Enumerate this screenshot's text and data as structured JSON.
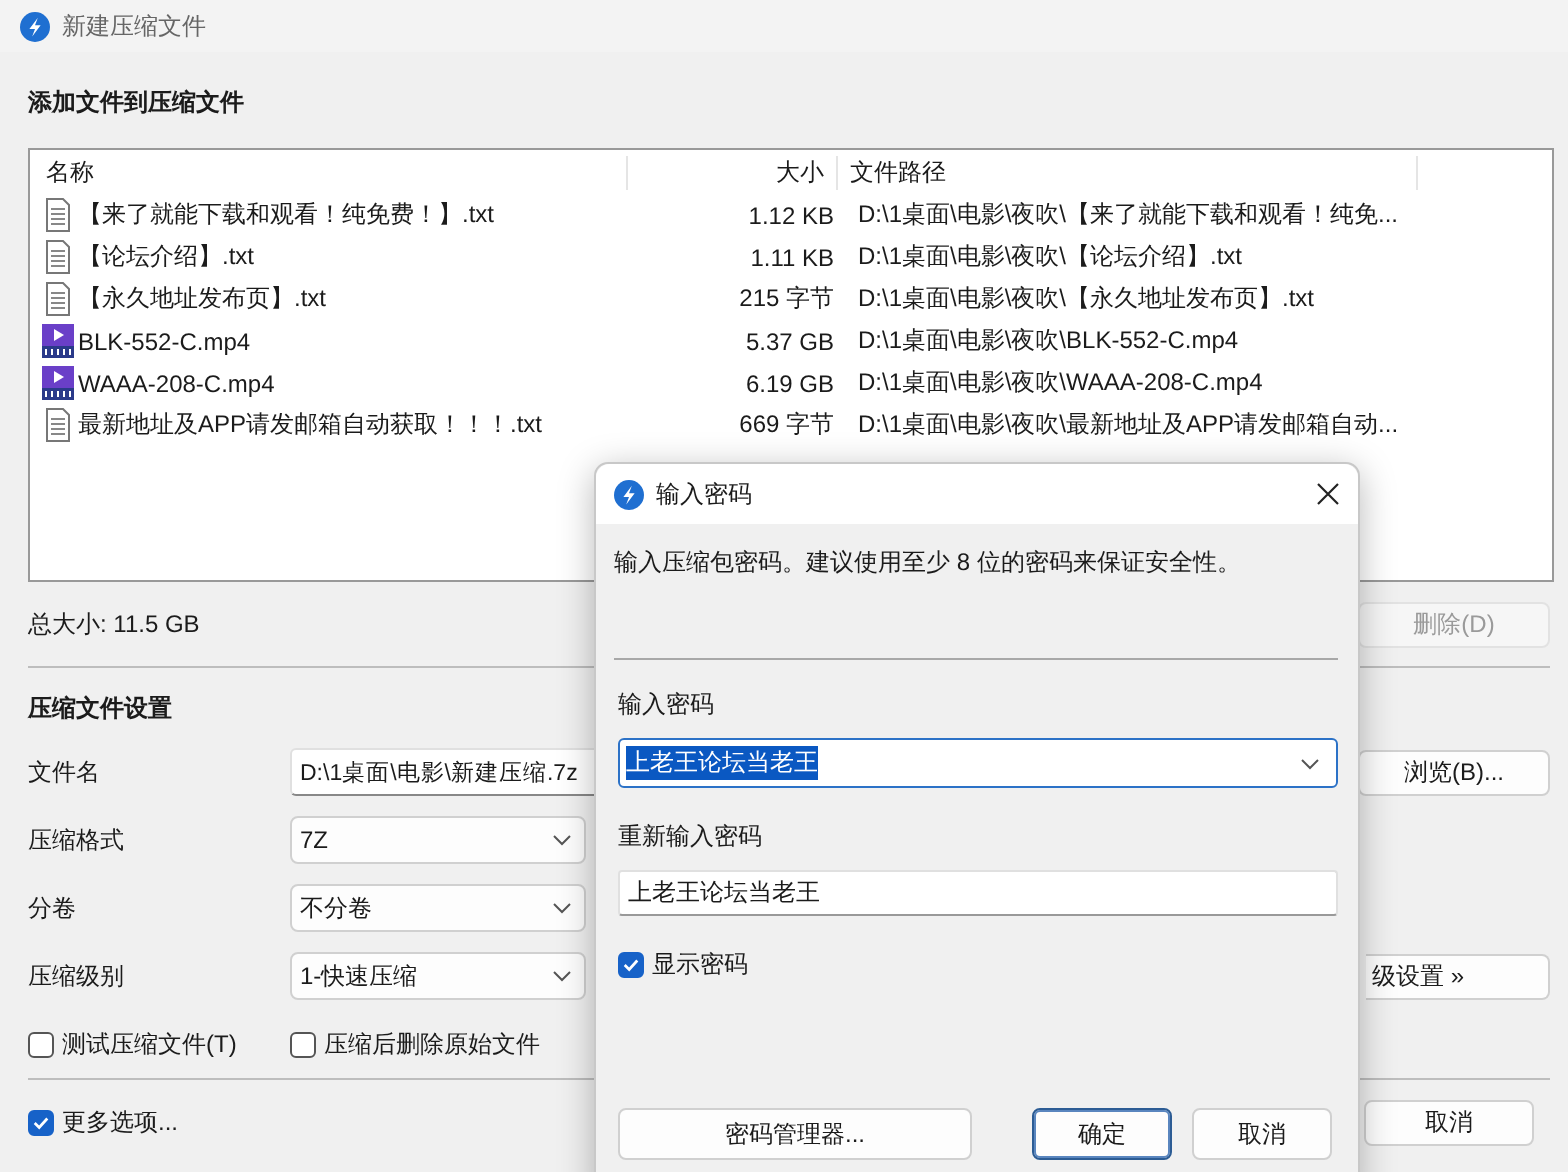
{
  "window": {
    "title": "新建压缩文件"
  },
  "files_section": {
    "heading": "添加文件到压缩文件",
    "columns": [
      "名称",
      "大小",
      "文件路径"
    ],
    "rows": [
      {
        "kind": "text",
        "name": "【来了就能下载和观看！纯免费！】.txt",
        "size": "1.12 KB",
        "path": "D:\\1桌面\\电影\\夜吹\\【来了就能下载和观看！纯免..."
      },
      {
        "kind": "text",
        "name": "【论坛介绍】.txt",
        "size": "1.11 KB",
        "path": "D:\\1桌面\\电影\\夜吹\\【论坛介绍】.txt"
      },
      {
        "kind": "text",
        "name": "【永久地址发布页】.txt",
        "size": "215 字节",
        "path": "D:\\1桌面\\电影\\夜吹\\【永久地址发布页】.txt"
      },
      {
        "kind": "video",
        "name": "BLK-552-C.mp4",
        "size": "5.37 GB",
        "path": "D:\\1桌面\\电影\\夜吹\\BLK-552-C.mp4"
      },
      {
        "kind": "video",
        "name": "WAAA-208-C.mp4",
        "size": "6.19 GB",
        "path": "D:\\1桌面\\电影\\夜吹\\WAAA-208-C.mp4"
      },
      {
        "kind": "text",
        "name": "最新地址及APP请发邮箱自动获取！！！.txt",
        "size": "669 字节",
        "path": "D:\\1桌面\\电影\\夜吹\\最新地址及APP请发邮箱自动..."
      }
    ],
    "total": "总大小: 11.5 GB",
    "delete_button": {
      "label": "删除(D)",
      "disabled": true
    }
  },
  "settings": {
    "heading": "压缩文件设置",
    "file_name": {
      "label": "文件名",
      "value": "D:\\1桌面\\电影\\新建压缩.7z"
    },
    "browse_button": "浏览(B)...",
    "selects": [
      {
        "label": "压缩格式",
        "value": "7Z"
      },
      {
        "label": "分卷",
        "value": "不分卷"
      },
      {
        "label": "压缩级别",
        "value": "1-快速压缩"
      }
    ],
    "advanced_button": "级设置 »",
    "options": [
      {
        "label": "测试压缩文件(T)",
        "checked": false
      },
      {
        "label": "压缩后删除原始文件",
        "checked": false
      }
    ]
  },
  "more_options": {
    "label": "更多选项...",
    "checked": true
  },
  "cancel_button": "取消",
  "password_dialog": {
    "title": "输入密码",
    "description": "输入压缩包密码。建议使用至少 8 位的密码来保证安全性。",
    "password": {
      "label": "输入密码",
      "value": "上老王论坛当老王",
      "highlighted": true
    },
    "confirm": {
      "label": "重新输入密码",
      "value": "上老王论坛当老王"
    },
    "show_password": {
      "label": "显示密码",
      "checked": true
    },
    "buttons": [
      {
        "label": "密码管理器...",
        "default": false
      },
      {
        "label": "确定",
        "default": true
      },
      {
        "label": "取消",
        "default": false
      }
    ]
  }
}
